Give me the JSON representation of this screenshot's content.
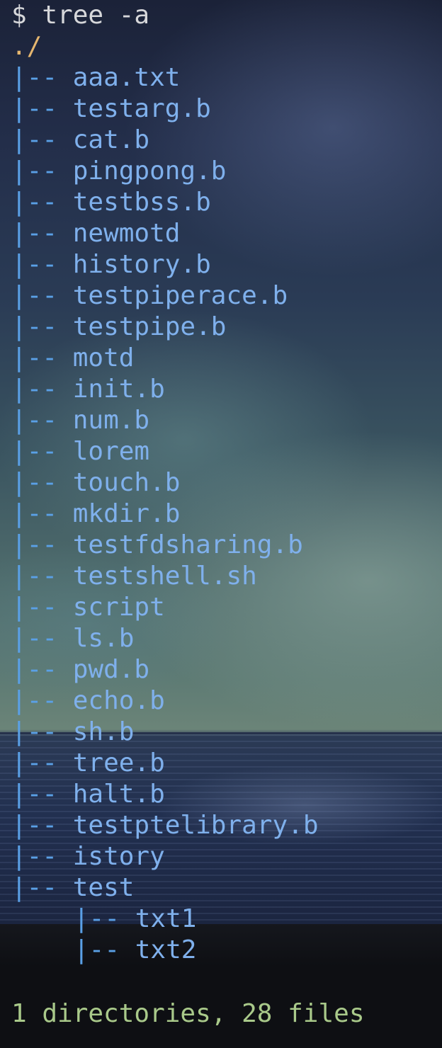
{
  "terminal": {
    "prompt": "$",
    "command": "tree -a",
    "root": "./",
    "branch": "|--",
    "entries": [
      "aaa.txt",
      "testarg.b",
      "cat.b",
      "pingpong.b",
      "testbss.b",
      "newmotd",
      "history.b",
      "testpiperace.b",
      "testpipe.b",
      "motd",
      "init.b",
      "num.b",
      "lorem",
      "touch.b",
      "mkdir.b",
      "testfdsharing.b",
      "testshell.sh",
      "script",
      "ls.b",
      "pwd.b",
      "echo.b",
      "sh.b",
      "tree.b",
      "halt.b",
      "testptelibrary.b",
      "istory",
      "test"
    ],
    "sub_entries": [
      "txt1",
      "txt2"
    ],
    "summary": "1 directories, 28 files"
  },
  "colors": {
    "prompt": "#d6d7da",
    "root": "#e5b66f",
    "tree_branch": "#5aa0e6",
    "file_name": "#7fb0ec",
    "summary": "#a9c98a",
    "background_bottom": "#0e0f13"
  },
  "icons": {
    "background": "night-sea-wallpaper"
  }
}
